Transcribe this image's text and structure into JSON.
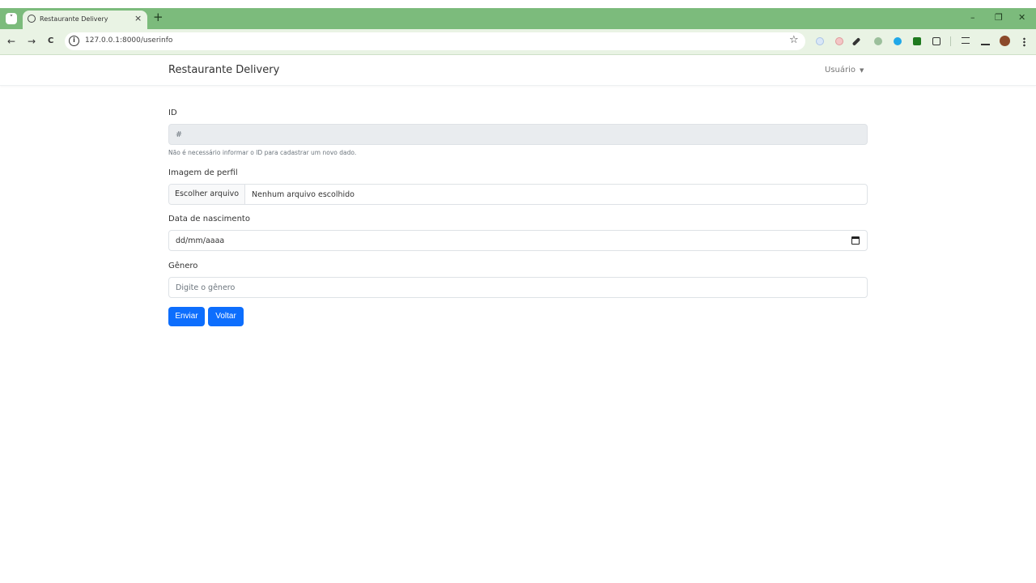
{
  "browser": {
    "tab_title": "Restaurante Delivery",
    "tab_close": "×",
    "new_tab": "+",
    "url": "127.0.0.1:8000/userinfo",
    "info_icon": "i",
    "star_icon": "☆",
    "back_icon": "←",
    "forward_icon": "→",
    "reload_icon": "C",
    "minimize": "–",
    "restore": "❐",
    "close": "✕",
    "tab_search": "˅"
  },
  "navbar": {
    "brand": "Restaurante Delivery",
    "user_menu": "Usuário",
    "caret": "▼"
  },
  "form": {
    "id_label": "ID",
    "id_placeholder": "#",
    "id_help": "Não é necessário informar o ID para cadastrar um novo dado.",
    "image_label": "Imagem de perfil",
    "file_button": "Escolher arquivo",
    "file_status": "Nenhum arquivo escolhido",
    "birth_label": "Data de nascimento",
    "birth_placeholder": "dd/mm/aaaa",
    "gender_label": "Gênero",
    "gender_placeholder": "Digite o gênero",
    "submit_label": "Enviar",
    "back_label": "Voltar"
  },
  "colors": {
    "tabbar": "#7cbb7c",
    "toolbar": "#e9f3e4",
    "primary": "#0d6efd",
    "disabled_field": "#e9ecef"
  }
}
